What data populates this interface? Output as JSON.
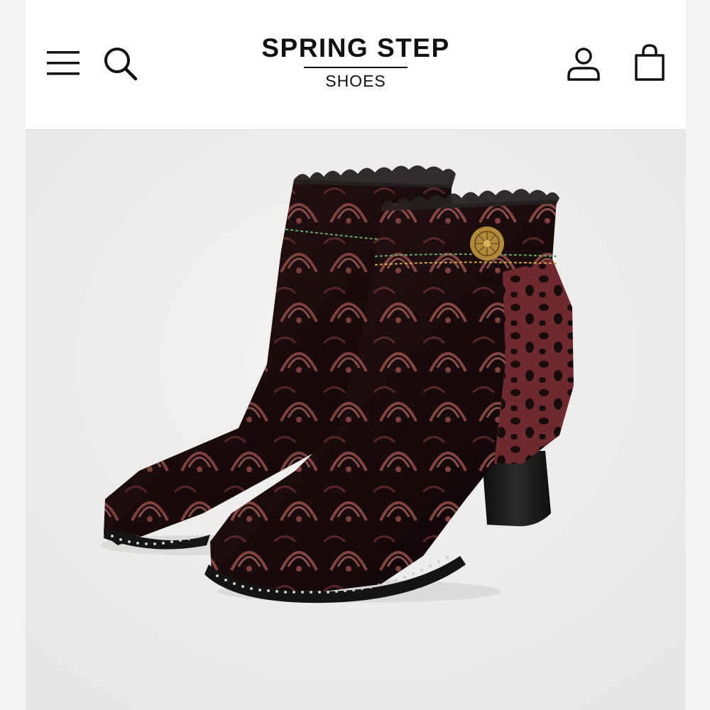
{
  "header": {
    "brand_name": "SPRING STEP",
    "brand_sub": "SHOES",
    "icons": {
      "menu": "hamburger-menu-icon",
      "search": "search-icon",
      "account": "account-icon",
      "bag": "shopping-bag-icon"
    }
  },
  "product": {
    "image": "ankle-boots-product-image"
  },
  "colors": {
    "header_bg": "#ffffff",
    "page_bg": "#efeeec",
    "text": "#111111",
    "boot_base": "#1a0d0e",
    "boot_accent": "#b9615c"
  }
}
